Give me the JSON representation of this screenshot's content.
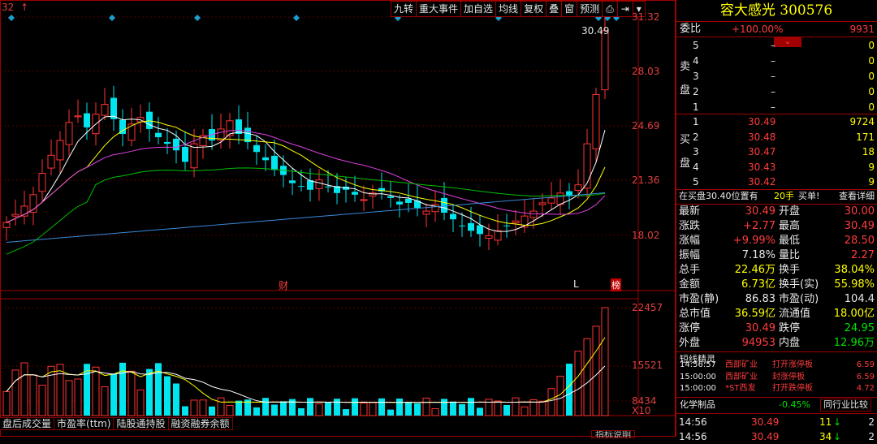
{
  "toolbar": {
    "buttons": [
      "九转",
      "重大事件",
      "加自选",
      "均线",
      "复权",
      "叠",
      "窗",
      "预测"
    ],
    "icon_lock": "lock-icon",
    "icon_play": "play-icon",
    "icon_down": "chevron-down-icon"
  },
  "top_left_label": "32",
  "top_left_marker": "↑",
  "price_axis": [
    "31.32",
    "28.03",
    "24.69",
    "21.36",
    "18.02"
  ],
  "volume_axis": [
    "22457",
    "15521",
    "8434"
  ],
  "volume_unit": "X10",
  "last_price_tag": "30.49",
  "markers": {
    "cai": "财",
    "L": "L",
    "bang": "榜"
  },
  "bottom_tabs": [
    "盘后成交量",
    "市盈率(ttm)",
    "陆股通持股",
    "融资融券余额"
  ],
  "bottom_hint": "指标说明",
  "stock": {
    "name": "容大感光",
    "code": "300576"
  },
  "weibi": {
    "label": "委比",
    "value": "+100.00%",
    "diff": "9931"
  },
  "sell_label": "卖盘",
  "buy_label": "买盘",
  "sell_rows": [
    {
      "n": "5",
      "price": "–",
      "vol": "0"
    },
    {
      "n": "4",
      "price": "–",
      "vol": "0"
    },
    {
      "n": "3",
      "price": "–",
      "vol": "0"
    },
    {
      "n": "2",
      "price": "–",
      "vol": "0"
    },
    {
      "n": "1",
      "price": "–",
      "vol": "0"
    }
  ],
  "buy_rows": [
    {
      "n": "1",
      "price": "30.49",
      "vol": "9724"
    },
    {
      "n": "2",
      "price": "30.48",
      "vol": "171"
    },
    {
      "n": "3",
      "price": "30.47",
      "vol": "18"
    },
    {
      "n": "4",
      "price": "30.43",
      "vol": "9"
    },
    {
      "n": "5",
      "price": "30.42",
      "vol": "9"
    }
  ],
  "notice": {
    "text": "在买盘30.40位置有",
    "vol": "20手",
    "action": "买单!",
    "link": "查看详细"
  },
  "quote": [
    {
      "l1": "最新",
      "v1": "30.49",
      "c1": "red",
      "l2": "开盘",
      "v2": "30.00",
      "c2": "red"
    },
    {
      "l1": "涨跌",
      "v1": "+2.77",
      "c1": "red",
      "l2": "最高",
      "v2": "30.49",
      "c2": "red"
    },
    {
      "l1": "涨幅",
      "v1": "+9.99%",
      "c1": "red",
      "l2": "最低",
      "v2": "28.50",
      "c2": "red"
    },
    {
      "l1": "振幅",
      "v1": "7.18%",
      "c1": "white",
      "l2": "量比",
      "v2": "2.27",
      "c2": "red"
    },
    {
      "l1": "总手",
      "v1": "22.46万",
      "c1": "yellow",
      "l2": "换手",
      "v2": "38.04%",
      "c2": "yellow"
    },
    {
      "l1": "金额",
      "v1": "6.73亿",
      "c1": "yellow",
      "l2": "换手(实)",
      "v2": "55.98%",
      "c2": "yellow"
    },
    {
      "l1": "市盈(静)",
      "v1": "86.83",
      "c1": "white",
      "l2": "市盈(动)",
      "v2": "104.4",
      "c2": "white"
    },
    {
      "l1": "总市值",
      "v1": "36.59亿",
      "c1": "yellow",
      "l2": "流通值",
      "v2": "18.00亿",
      "c2": "yellow"
    },
    {
      "l1": "涨停",
      "v1": "30.49",
      "c1": "red",
      "l2": "跌停",
      "v2": "24.95",
      "c2": "green"
    },
    {
      "l1": "外盘",
      "v1": "94953",
      "c1": "red",
      "l2": "内盘",
      "v2": "12.96万",
      "c2": "green"
    }
  ],
  "sprite": {
    "title": "短线精灵",
    "rows": [
      {
        "time": "14:56:57",
        "name": "西部矿业",
        "event": "打开涨停板",
        "val": "6.59"
      },
      {
        "time": "15:00:00",
        "name": "西部矿业",
        "event": "封涨停板",
        "val": "6.59"
      },
      {
        "time": "15:00:00",
        "name": "*ST西发",
        "event": "打开跌停板",
        "val": "4.72"
      }
    ]
  },
  "industry": {
    "name": "化学制品",
    "change": "-0.45%",
    "link": "同行业比较"
  },
  "ticks": [
    {
      "time": "14:56",
      "price": "30.49",
      "vol": "11",
      "dir": "↓",
      "extra": "2"
    },
    {
      "time": "14:56",
      "price": "30.49",
      "vol": "34",
      "dir": "↓",
      "extra": "2"
    }
  ],
  "colors": {
    "up": "#ff3232",
    "down": "#00e5ee",
    "ma5": "#ffffff",
    "ma10": "#ffff00",
    "ma20": "#e040e0",
    "ma60": "#00c000",
    "ma120": "#3a8ad8",
    "frame": "#a00000"
  }
}
